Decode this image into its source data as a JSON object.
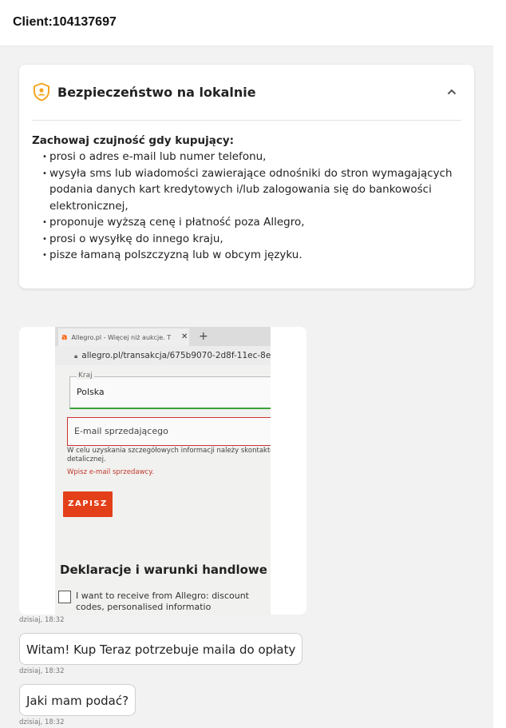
{
  "header": {
    "title": "Client:104137697"
  },
  "safety_card": {
    "title": "Bezpieczeństwo na lokalnie",
    "icon": "shield-person-icon",
    "accent_color": "#f5a623",
    "heading": "Zachowaj czujność gdy kupujący:",
    "items": [
      {
        "text": "prosi o adres e-mail lub numer telefonu,"
      },
      {
        "text": "wysyła sms lub wiadomości zawierające odnośniki do stron wymagających podania danych kart kredytowych i/lub zalogowania się do bankowości elektronicznej,"
      },
      {
        "text": "proponuje wyższą cenę i płatność poza Allegro,"
      },
      {
        "text": "prosi o wysyłkę do innego kraju,"
      },
      {
        "text": "pisze łamaną polszczyzną lub w obcym języku."
      }
    ]
  },
  "photo": {
    "tab_title": "Allegro.pl - Więcej niż aukcje. T",
    "url": "allegro.pl/transakcja/675b9070-2d8f-11ec-8e0",
    "country_label": "Kraj",
    "country_value": "Polska",
    "email_label": "E-mail sprzedającego",
    "help_text": "W celu uzyskania szczegółowych informacji należy skontakto detalicznej.",
    "error_text": "Wpisz e-mail sprzedawcy.",
    "save_button": "ZAPISZ",
    "section_heading": "Deklaracje i warunki handlowe",
    "checkbox_label": "I want to receive from Allegro: discount codes, personalised informatio"
  },
  "messages": [
    {
      "timestamp": "dzisiaj, 18:32",
      "text": ""
    },
    {
      "timestamp": "dzisiaj, 18:32",
      "text": "Witam! Kup Teraz potrzebuje maila do opłaty"
    },
    {
      "timestamp": "dzisiaj, 18:32",
      "text": "Jaki mam podać?"
    }
  ]
}
